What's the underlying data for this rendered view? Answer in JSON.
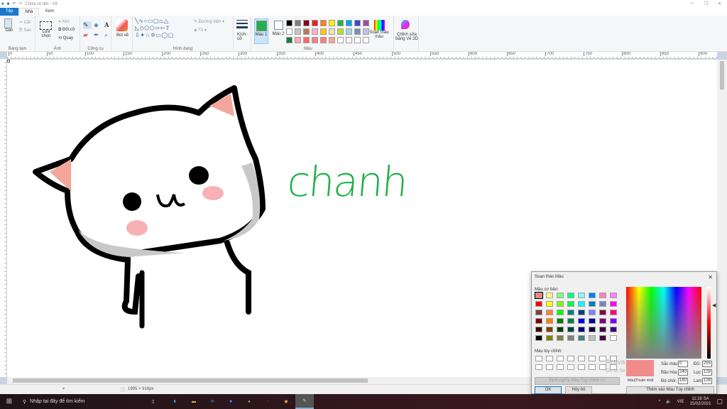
{
  "window": {
    "title": "Chưa có tên - Vẽ"
  },
  "tabs": [
    "Tệp",
    "Nhà",
    "Xem"
  ],
  "ribbon": {
    "clipboard": {
      "paste": "Dán",
      "cut": "Cắt",
      "copy": "Sao",
      "label": "Bảng tạm"
    },
    "image": {
      "select": "Lựa chọn",
      "crop": "Xén",
      "resize": "Đổi cỡ",
      "rotate": "Quay",
      "label": "Ảnh"
    },
    "tools": {
      "label": "Công cụ"
    },
    "brushes": {
      "label": "Bút vẽ"
    },
    "shapes": {
      "outline": "Đường viền",
      "fill": "Tô",
      "label": "Hình dạng"
    },
    "size": {
      "label": "Kích cỡ"
    },
    "colors": {
      "color1": "Màu 1",
      "color2": "Màu 2",
      "edit": "Soạn thảo màu",
      "label": "Màu",
      "color1_value": "#22b14c",
      "color2_value": "#ffffff",
      "palette": [
        [
          "#000000",
          "#7f7f7f",
          "#880015",
          "#ed1c24",
          "#ff7f27",
          "#fff200",
          "#22b14c",
          "#00a2e8",
          "#3f48cc",
          "#a349a4"
        ],
        [
          "#ffffff",
          "#c3c3c3",
          "#b97a57",
          "#ffaec9",
          "#ffc90e",
          "#efe4b0",
          "#b5e61d",
          "#99d9ea",
          "#7092be",
          "#c8bfe7"
        ],
        [
          "#1e7b3a",
          "#ffaaaa",
          "#ff6666",
          "#ff8080",
          "#ff8080",
          "#f9a88c",
          "#ffffff",
          "#ffffff",
          "#ffffff",
          "#ffffff"
        ]
      ]
    },
    "paint3d": "Chỉnh sửa bằng Vẽ 3D"
  },
  "ruler": {
    "h": [
      "0",
      "50",
      "100",
      "150",
      "200",
      "250",
      "300",
      "350",
      "400",
      "450",
      "500",
      "550",
      "600",
      "650",
      "700",
      "750",
      "800",
      "850",
      "900",
      "950"
    ]
  },
  "canvas": {
    "text": "chanh"
  },
  "status": {
    "size": "1895 × 916px"
  },
  "dialog": {
    "title": "Soạn thảo Màu",
    "basic_label": "Màu cơ bản:",
    "basic": [
      "#ff8080",
      "#ffff80",
      "#80ff80",
      "#00ff80",
      "#80ffff",
      "#0080ff",
      "#ff80c0",
      "#ff80ff",
      "#ff0000",
      "#ffff00",
      "#80ff00",
      "#00ff40",
      "#00ffff",
      "#0080c0",
      "#8080c0",
      "#ff00ff",
      "#804040",
      "#ff8040",
      "#00ff00",
      "#008080",
      "#004080",
      "#8080ff",
      "#800040",
      "#ff0080",
      "#800000",
      "#ff8000",
      "#008000",
      "#008040",
      "#0000ff",
      "#0000a0",
      "#800080",
      "#8000ff",
      "#400000",
      "#804000",
      "#004000",
      "#004040",
      "#000080",
      "#000040",
      "#400040",
      "#400080",
      "#000000",
      "#808000",
      "#808040",
      "#808080",
      "#408080",
      "#c0c0c0",
      "#400040",
      "#ffffff"
    ],
    "custom_label": "Màu tùy chỉnh:",
    "define_button": "Định nghĩa Màu Tùy chỉnh >>",
    "ok": "OK",
    "cancel": "Hủy bỏ",
    "solid_label": "Màu|Thuần nhất",
    "selected_color": "#f28b8b",
    "hue_label": "Sắc màu:",
    "hue": "0",
    "sat_label": "Bão hòa:",
    "sat": "240",
    "lum_label": "Độ chói:",
    "lum": "180",
    "red_label": "Đỏ:",
    "red": "255",
    "green_label": "Lục:",
    "green": "128",
    "blue_label": "Lam:",
    "blue": "128",
    "add_button": "Thêm vào Màu Tùy chỉnh"
  },
  "watermark": {
    "line1": "Activa",
    "line2": "Go to Se"
  },
  "taskbar": {
    "search": "Nhập tại đây để tìm kiếm",
    "lang": "VIE",
    "time": "11:28 SA",
    "date": "15/02/2021"
  }
}
